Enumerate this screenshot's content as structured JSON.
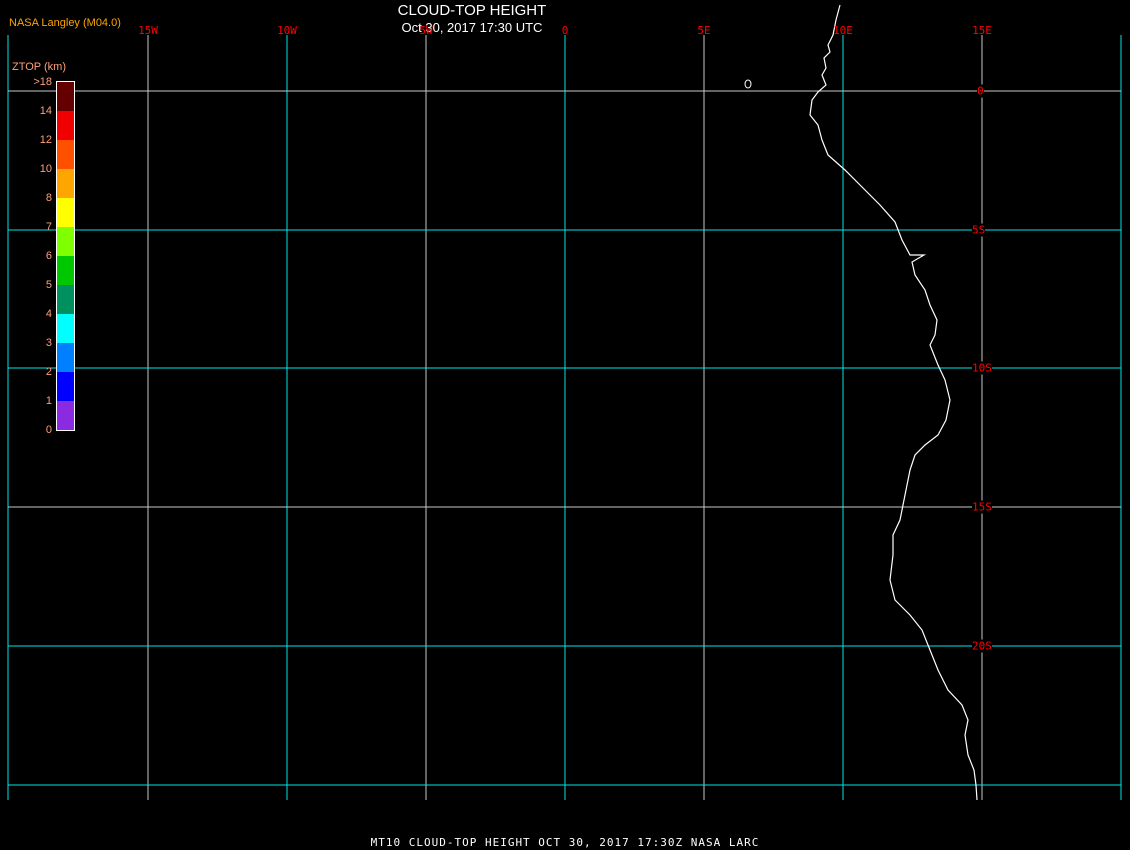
{
  "header": {
    "title": "CLOUD-TOP HEIGHT",
    "subtitle": "Oct 30, 2017 17:30 UTC",
    "credit": "NASA Langley (M04.0)"
  },
  "map": {
    "lon_labels": [
      "15W",
      "10W",
      "5W",
      "0",
      "5E",
      "10E",
      "15E"
    ],
    "lat_labels": [
      "0",
      "5S",
      "10S",
      "15S",
      "20S"
    ],
    "grid_colors": [
      "#00e5e5",
      "#c8c8c8"
    ],
    "coastline_color": "#ffffff"
  },
  "legend": {
    "title": "ZTOP (km)",
    "labels": [
      ">18",
      "14",
      "12",
      "10",
      "8",
      "7",
      "6",
      "5",
      "4",
      "3",
      "2",
      "1",
      "0"
    ],
    "colors": [
      "#640000",
      "#f00000",
      "#ff5000",
      "#ffa500",
      "#ffff00",
      "#80ff00",
      "#00c800",
      "#009060",
      "#00ffff",
      "#0080ff",
      "#0000ff",
      "#8a2be2"
    ]
  },
  "footer": {
    "text": "MT10  CLOUD-TOP HEIGHT   OCT 30, 2017 17:30Z   NASA LARC"
  }
}
